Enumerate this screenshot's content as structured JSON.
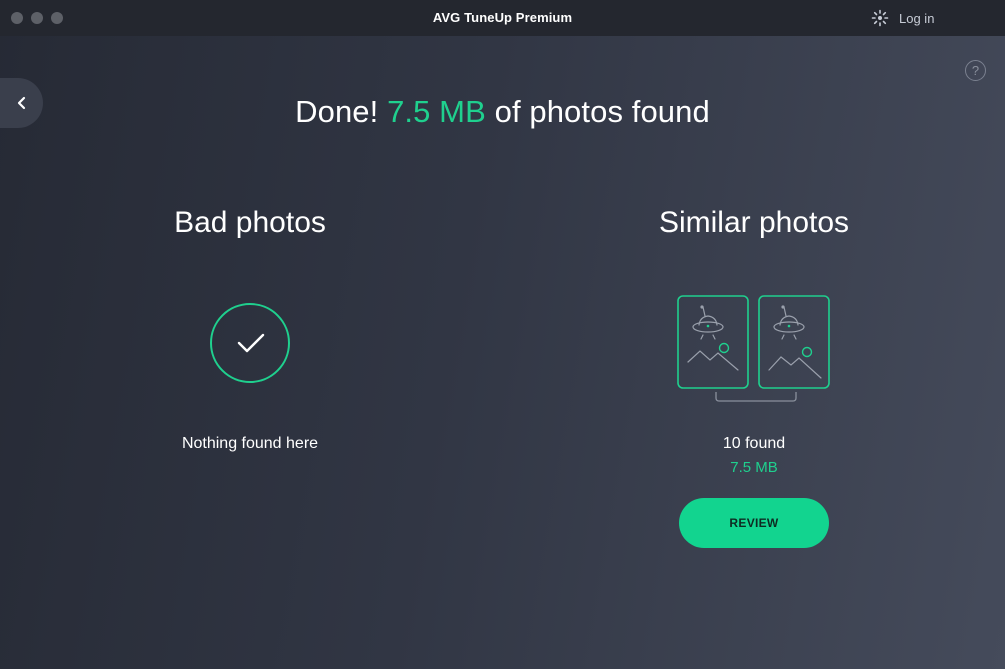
{
  "window": {
    "title": "AVG TuneUp Premium",
    "login_label": "Log in"
  },
  "headline": {
    "prefix": "Done! ",
    "size": "7.5 MB",
    "suffix": " of photos found"
  },
  "bad_photos": {
    "title": "Bad photos",
    "status": "Nothing found here"
  },
  "similar_photos": {
    "title": "Similar photos",
    "count": "10 found",
    "size": "7.5 MB",
    "review_label": "REVIEW"
  },
  "help": {
    "label": "?"
  },
  "colors": {
    "accent": "#1fd08e",
    "background": "#2f3441",
    "titlebar": "#24272f"
  },
  "icons": {
    "back": "chevron-left-icon",
    "help": "question-circle-icon",
    "login": "user-spinner-icon",
    "check": "check-icon",
    "photos": "similar-photos-icon"
  }
}
